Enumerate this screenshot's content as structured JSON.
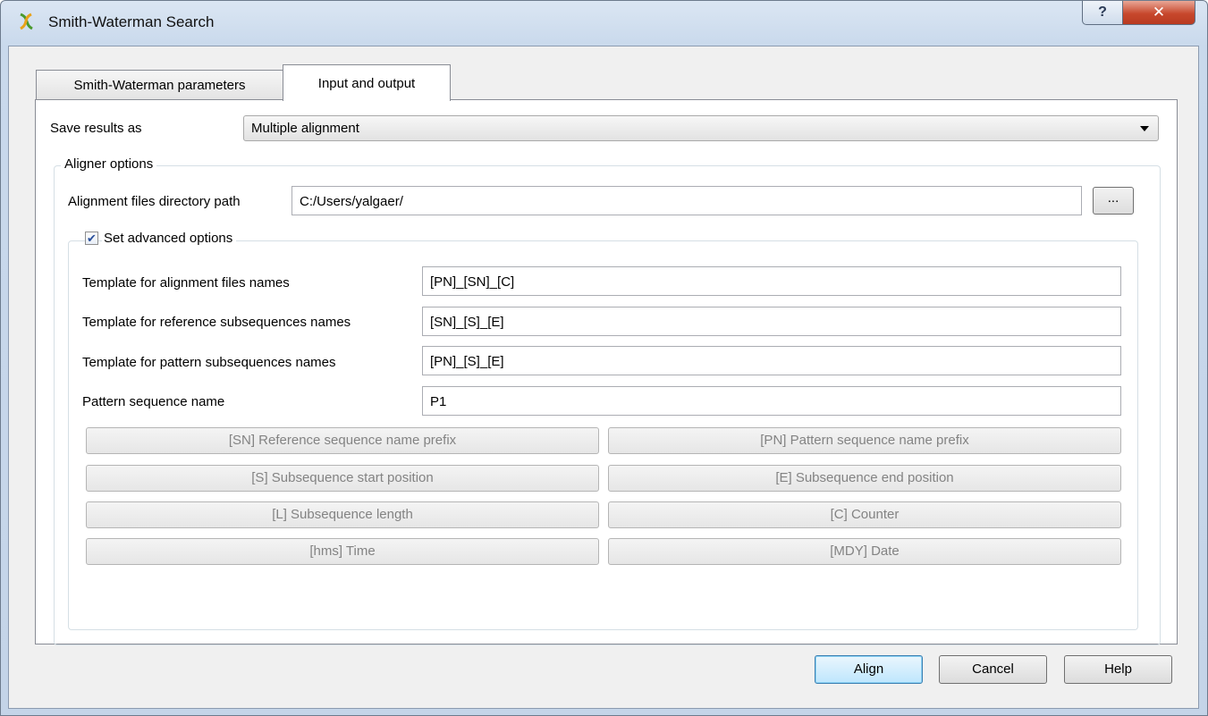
{
  "window": {
    "title": "Smith-Waterman Search",
    "help_glyph": "?",
    "close_glyph": "✕"
  },
  "tabs": [
    {
      "label": "Smith-Waterman parameters",
      "active": false
    },
    {
      "label": "Input and output",
      "active": true
    }
  ],
  "save_results": {
    "label": "Save results as",
    "value": "Multiple alignment"
  },
  "aligner_options": {
    "title": "Aligner options",
    "dir_label": "Alignment files directory path",
    "dir_value": "C:/Users/yalgaer/",
    "browse_label": "...",
    "advanced": {
      "label": "Set advanced options",
      "checked": true,
      "fields": [
        {
          "label": "Template for alignment files names",
          "value": "[PN]_[SN]_[C]"
        },
        {
          "label": "Template for reference subsequences names",
          "value": "[SN]_[S]_[E]"
        },
        {
          "label": "Template for pattern subsequences names",
          "value": "[PN]_[S]_[E]"
        },
        {
          "label": "Pattern sequence name",
          "value": "P1"
        }
      ],
      "tag_buttons": [
        "[SN] Reference sequence name prefix",
        "[PN] Pattern sequence name prefix",
        "[S] Subsequence start position",
        "[E] Subsequence end position",
        "[L] Subsequence length",
        "[C] Counter",
        "[hms] Time",
        "[MDY] Date"
      ]
    }
  },
  "buttons": {
    "align": "Align",
    "cancel": "Cancel",
    "help": "Help"
  },
  "colors": {
    "title_bar": "#c9d9ec",
    "close_button": "#c7482d",
    "default_button_border": "#3c7fb1",
    "disabled_text": "#838383"
  }
}
